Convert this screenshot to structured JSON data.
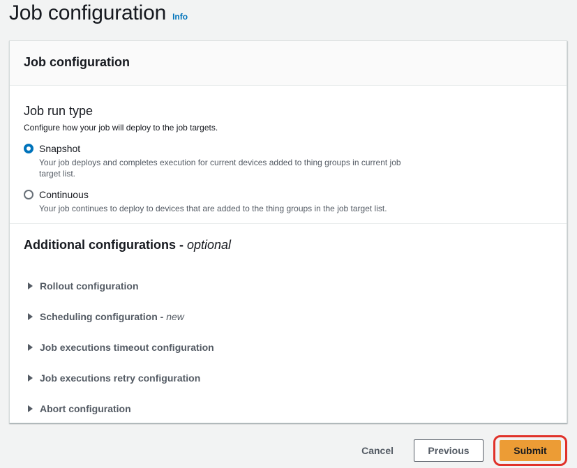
{
  "page": {
    "title": "Job configuration",
    "info_link": "Info"
  },
  "container": {
    "title": "Job configuration"
  },
  "job_run_type": {
    "title": "Job run type",
    "description": "Configure how your job will deploy to the job targets.",
    "options": [
      {
        "label": "Snapshot",
        "description": "Your job deploys and completes execution for current devices added to thing groups in current job target list.",
        "selected": true
      },
      {
        "label": "Continuous",
        "description": "Your job continues to deploy to devices that are added to the thing groups in the job target list.",
        "selected": false
      }
    ]
  },
  "additional": {
    "title": "Additional configurations -",
    "optional": "optional",
    "expanders": [
      {
        "label": "Rollout configuration",
        "suffix": ""
      },
      {
        "label": "Scheduling configuration -",
        "suffix": "new"
      },
      {
        "label": "Job executions timeout configuration",
        "suffix": ""
      },
      {
        "label": "Job executions retry configuration",
        "suffix": ""
      },
      {
        "label": "Abort configuration",
        "suffix": ""
      }
    ]
  },
  "actions": {
    "cancel": "Cancel",
    "previous": "Previous",
    "submit": "Submit"
  },
  "colors": {
    "primary_button": "#ec9c35",
    "highlight_border": "#e0322a",
    "link": "#0073bb",
    "radio_selected": "#0073bb"
  }
}
